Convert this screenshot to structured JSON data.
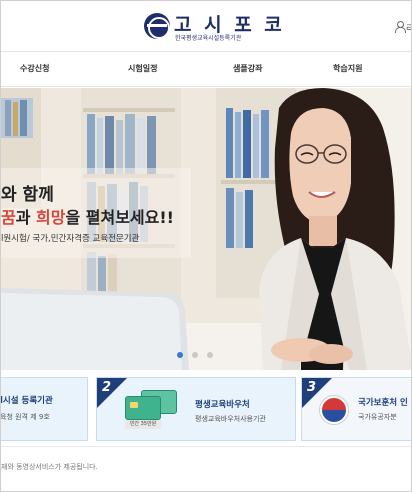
{
  "header": {
    "logo_title": "고 시 포 코",
    "logo_subtitle": "한국평생교육시설등록기관",
    "user_label": "ㄹ"
  },
  "nav": {
    "items": [
      "수강신청",
      "시험일정",
      "샘플강좌",
      "학습지원"
    ]
  },
  "hero": {
    "line1": "와 함께",
    "line2_part1": "꿈",
    "line2_part2": "과 ",
    "line2_part3": "희망",
    "line2_part4": "을 펼쳐보세요!!",
    "line3": "l원시험/ 국가,민간자격증 교육전문기관",
    "slide_count": 3,
    "active_slide": 1
  },
  "cards": [
    {
      "number": "",
      "title": "l시설 등록기관",
      "desc": "육청 원격 제 9호"
    },
    {
      "number": "2",
      "title": "평생교육바우처",
      "desc": "평생교육바우처사용기관",
      "badge": "민간 35만원"
    },
    {
      "number": "3",
      "title": "국가보훈처 인",
      "desc": "국가유공자분"
    }
  ],
  "footer": {
    "text": "재와 동영상서비스가 제공됩니다."
  },
  "colors": {
    "brand": "#1e2d6b",
    "highlight": "#d6463a",
    "slider_active": "#3c78c8",
    "card_bg": "#e9f3fc"
  }
}
